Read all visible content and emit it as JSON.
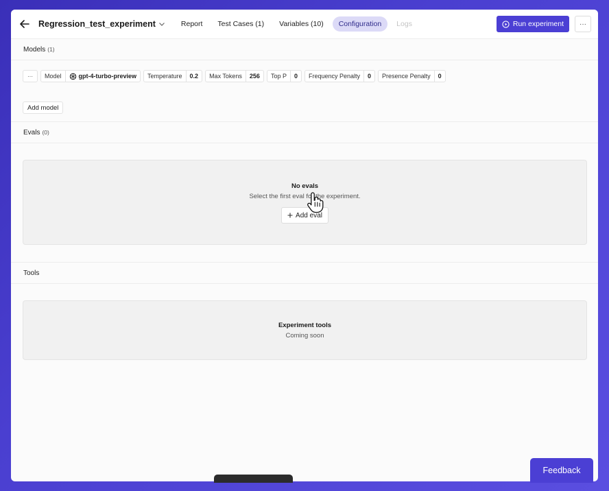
{
  "header": {
    "title": "Regression_test_experiment",
    "tabs": [
      {
        "label": "Report",
        "state": "normal"
      },
      {
        "label": "Test Cases (1)",
        "state": "normal"
      },
      {
        "label": "Variables (10)",
        "state": "normal"
      },
      {
        "label": "Configuration",
        "state": "active"
      },
      {
        "label": "Logs",
        "state": "disabled"
      }
    ],
    "run_label": "Run experiment",
    "more_label": "···"
  },
  "models": {
    "heading": "Models",
    "count": "(1)",
    "more_label": "···",
    "params": [
      {
        "label": "Model",
        "value": "gpt-4-turbo-preview"
      },
      {
        "label": "Temperature",
        "value": "0.2"
      },
      {
        "label": "Max Tokens",
        "value": "256"
      },
      {
        "label": "Top P",
        "value": "0"
      },
      {
        "label": "Frequency Penalty",
        "value": "0"
      },
      {
        "label": "Presence Penalty",
        "value": "0"
      }
    ],
    "add_label": "Add model"
  },
  "evals": {
    "heading": "Evals",
    "count": "(0)",
    "empty_title": "No evals",
    "empty_sub": "Select the first eval for the experiment.",
    "add_label": "Add eval"
  },
  "tools": {
    "heading": "Tools",
    "empty_title": "Experiment tools",
    "empty_sub": "Coming soon"
  },
  "feedback_label": "Feedback",
  "colors": {
    "accent": "#4b3fd4",
    "active_tab": "#dcdaf7"
  }
}
